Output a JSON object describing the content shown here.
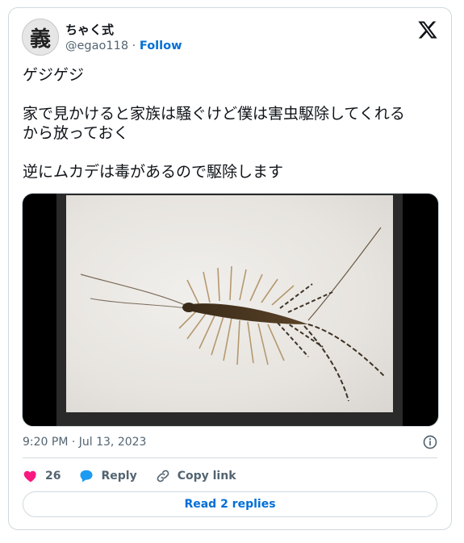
{
  "author": {
    "avatar_glyph": "義",
    "display_name": "ちゃく式",
    "handle": "@egao118",
    "separator": "·",
    "follow_label": "Follow"
  },
  "tweet": {
    "text": "ゲジゲジ\n\n家で見かけると家族は騒ぐけど僕は害虫駆除してくれる\nから放っておく\n\n逆にムカデは毒があるので駆除します",
    "timestamp": "9:20 PM · Jul 13, 2023"
  },
  "actions": {
    "like_count": "26",
    "reply_label": "Reply",
    "copy_link_label": "Copy link"
  },
  "read_replies_label": "Read 2 replies",
  "colors": {
    "like": "#f91880",
    "reply": "#1d9bf0",
    "link": "#006fd6"
  }
}
